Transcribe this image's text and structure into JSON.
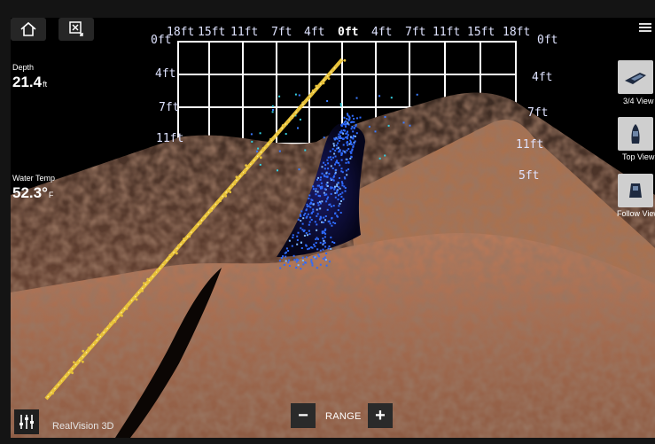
{
  "app": {
    "name": "RealVision 3D"
  },
  "toolbar": {
    "home_icon": "home-icon",
    "clear_icon": "clear-screen-icon",
    "menu_icon": "hamburger-menu-icon"
  },
  "readouts": [
    {
      "label": "Depth",
      "value": "21.4",
      "unit": "ft"
    },
    {
      "label": "Water Temp",
      "value": "52.3°",
      "unit": "F"
    }
  ],
  "scale": {
    "top_ticks": [
      "18ft",
      "15ft",
      "11ft",
      "7ft",
      "4ft",
      "0ft",
      "4ft",
      "7ft",
      "11ft",
      "15ft",
      "18ft"
    ],
    "left_ticks": [
      "0ft",
      "4ft",
      "7ft",
      "11ft"
    ],
    "right_ticks": [
      "0ft",
      "4ft",
      "7ft",
      "11ft",
      "5ft"
    ]
  },
  "views": [
    {
      "label": "3/4 View",
      "icon": "boat-three-quarter-view-icon"
    },
    {
      "label": "Top View",
      "icon": "boat-top-view-icon"
    },
    {
      "label": "Follow View",
      "icon": "boat-follow-view-icon"
    }
  ],
  "bottom": {
    "range_label": "RANGE",
    "minus": "−",
    "plus": "+"
  },
  "colors": {
    "seabed": "#9a6448",
    "fish_targets": "#2f6bff",
    "track": "#e8c23a",
    "grid": "#ffffff"
  }
}
